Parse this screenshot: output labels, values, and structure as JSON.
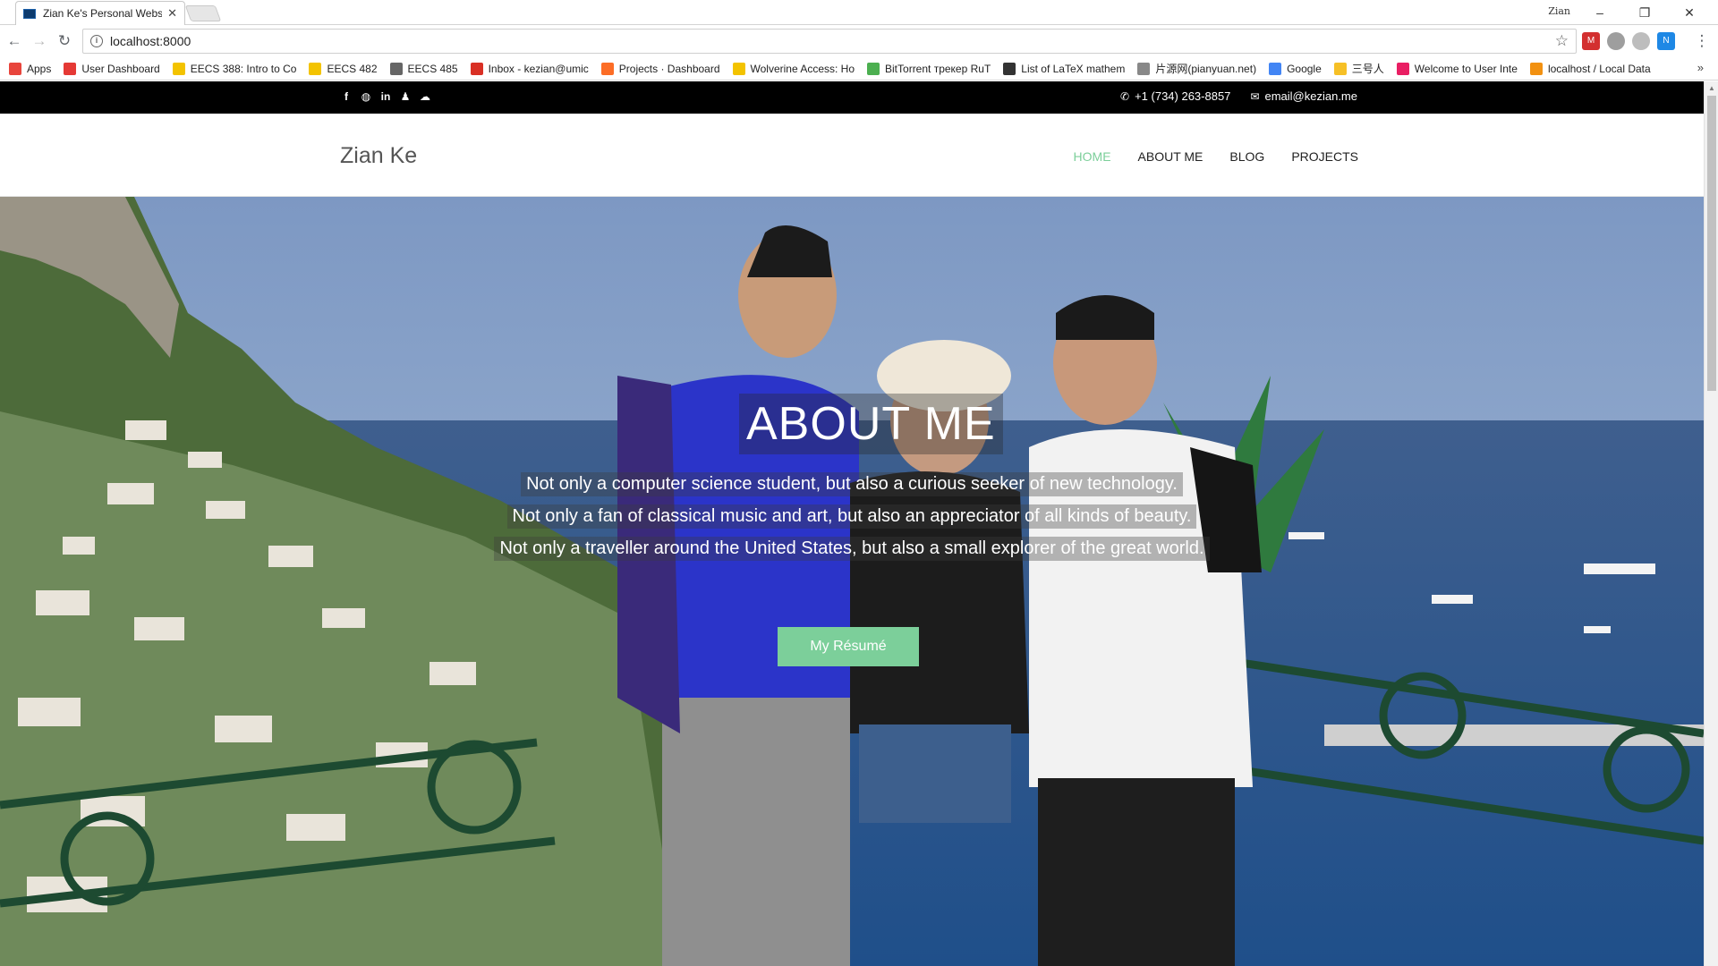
{
  "browser": {
    "tab_title": "Zian Ke's Personal Webs",
    "tab_close": "✕",
    "user_label": "Zian",
    "url": "localhost:8000",
    "bookmarks": [
      {
        "label": "Apps",
        "icon": "apps-grid-icon",
        "color": "#e8453c"
      },
      {
        "label": "User Dashboard",
        "icon": "user-dashboard-icon",
        "color": "#e53935"
      },
      {
        "label": "EECS 388: Intro to Co",
        "icon": "umich-m-icon",
        "color": "#f3c300"
      },
      {
        "label": "EECS 482",
        "icon": "umich-m-icon",
        "color": "#f3c300"
      },
      {
        "label": "EECS 485",
        "icon": "eecs-icon",
        "color": "#666666"
      },
      {
        "label": "Inbox - kezian@umic",
        "icon": "gmail-icon",
        "color": "#d93025"
      },
      {
        "label": "Projects · Dashboard",
        "icon": "gitlab-icon",
        "color": "#fc6d26"
      },
      {
        "label": "Wolverine Access: Ho",
        "icon": "umich-m-icon",
        "color": "#f3c300"
      },
      {
        "label": "BitTorrent трекер RuT",
        "icon": "bittorrent-icon",
        "color": "#4caf50"
      },
      {
        "label": "List of LaTeX mathem",
        "icon": "tex-icon",
        "color": "#333333"
      },
      {
        "label": "片源网(pianyuan.net)",
        "icon": "page-icon",
        "color": "#888888"
      },
      {
        "label": "Google",
        "icon": "google-icon",
        "color": "#4285f4"
      },
      {
        "label": "三号人",
        "icon": "folder-icon",
        "color": "#f6c026"
      },
      {
        "label": "Welcome to User Inte",
        "icon": "site-icon",
        "color": "#e91e63"
      },
      {
        "label": "localhost / Local Data",
        "icon": "phpmyadmin-icon",
        "color": "#f29111"
      }
    ]
  },
  "site": {
    "social_icons": [
      "facebook-icon",
      "github-icon",
      "linkedin-icon",
      "qq-icon",
      "wechat-icon"
    ],
    "phone": "+1 (734) 263-8857",
    "email": "email@kezian.me",
    "brand": "Zian Ke",
    "menu": [
      {
        "label": "HOME",
        "active": true
      },
      {
        "label": "ABOUT ME",
        "active": false
      },
      {
        "label": "BLOG",
        "active": false
      },
      {
        "label": "PROJECTS",
        "active": false
      }
    ],
    "hero": {
      "title": "ABOUT ME",
      "lines": [
        "Not only a computer science student, but also a curious seeker of new technology.",
        "Not only a fan of classical music and art, but also an appreciator of all kinds of beauty.",
        "Not only a traveller around the United States, but also a small explorer of the great world."
      ],
      "button": "My Résumé"
    }
  },
  "colors": {
    "accent": "#7ccf9a",
    "topbar": "#000000"
  }
}
